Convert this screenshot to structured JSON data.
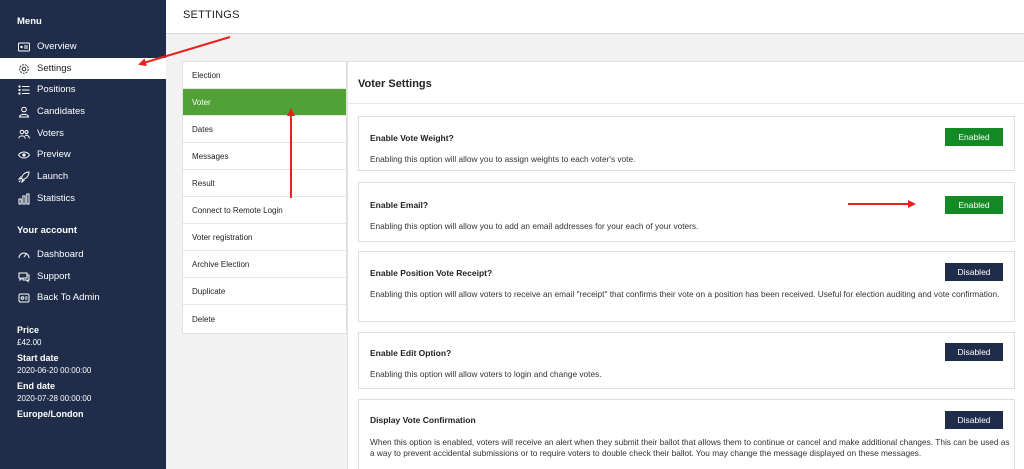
{
  "sidebar": {
    "menu_heading": "Menu",
    "items": [
      {
        "label": "Overview",
        "icon": "overview-icon"
      },
      {
        "label": "Settings",
        "icon": "gear-icon"
      },
      {
        "label": "Positions",
        "icon": "list-icon"
      },
      {
        "label": "Candidates",
        "icon": "person-icon"
      },
      {
        "label": "Voters",
        "icon": "people-icon"
      },
      {
        "label": "Preview",
        "icon": "eye-icon"
      },
      {
        "label": "Launch",
        "icon": "rocket-icon"
      },
      {
        "label": "Statistics",
        "icon": "bar-chart-icon"
      }
    ],
    "account_heading": "Your account",
    "account_items": [
      {
        "label": "Dashboard",
        "icon": "speedometer-icon"
      },
      {
        "label": "Support",
        "icon": "chat-icon"
      },
      {
        "label": "Back To Admin",
        "icon": "back-icon"
      }
    ],
    "info": {
      "price_label": "Price",
      "price_value": "£42.00",
      "start_label": "Start date",
      "start_value": "2020-06-20 00:00:00",
      "end_label": "End date",
      "end_value": "2020-07-28 00:00:00",
      "timezone": "Europe/London"
    }
  },
  "header": {
    "title": "SETTINGS"
  },
  "settings_nav": {
    "items": [
      "Election",
      "Voter",
      "Dates",
      "Messages",
      "Result",
      "Connect to Remote Login",
      "Voter registration",
      "Archive Election",
      "Duplicate",
      "Delete"
    ],
    "active": "Voter"
  },
  "panel": {
    "title": "Voter Settings",
    "cards": [
      {
        "title": "Enable Vote Weight?",
        "description": "Enabling this option will allow you to assign weights to each voter's vote.",
        "state": "Enabled"
      },
      {
        "title": "Enable Email?",
        "description": "Enabling this option will allow you to add an email addresses for your each of your voters.",
        "state": "Enabled"
      },
      {
        "title": "Enable Position Vote Receipt?",
        "description": "Enabling this option will allow voters to receive an email \"receipt\" that confirms their vote on a position has been received. Useful for election auditing and vote confirmation.",
        "state": "Disabled"
      },
      {
        "title": "Enable Edit Option?",
        "description": "Enabling this option will allow voters to login and change votes.",
        "state": "Disabled"
      },
      {
        "title": "Display Vote Confirmation",
        "description": "When this option is enabled, voters will receive an alert when they submit their ballot that allows them to continue or cancel and make additional changes. This can be used as a way to prevent accidental submissions or to require voters to double check their ballot. You may change the message displayed on these messages.",
        "state": "Disabled"
      }
    ]
  },
  "colors": {
    "sidebar": "#1f2d4a",
    "active_nav": "#52a136",
    "enabled": "#138a25",
    "disabled": "#1f2d4a",
    "annotation": "#e8231f"
  }
}
